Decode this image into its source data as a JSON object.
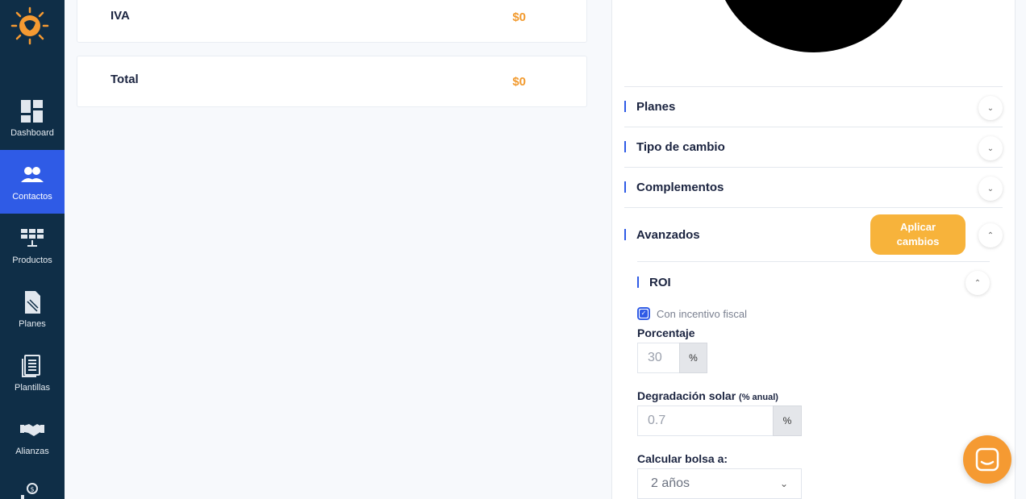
{
  "sidebar": {
    "items": [
      {
        "label": "Dashboard"
      },
      {
        "label": "Contactos"
      },
      {
        "label": "Productos"
      },
      {
        "label": "Planes"
      },
      {
        "label": "Plantillas"
      },
      {
        "label": "Alianzas"
      }
    ],
    "active_color": "#2f5be6",
    "bg_color": "#0f2e47"
  },
  "summary": {
    "iva": {
      "label": "IVA",
      "value": "$0"
    },
    "total": {
      "label": "Total",
      "value": "$0"
    },
    "value_color": "#f29a2e"
  },
  "panel": {
    "accordions": [
      {
        "title": "Planes"
      },
      {
        "title": "Tipo de cambio"
      },
      {
        "title": "Complementos"
      },
      {
        "title": "Avanzados"
      }
    ],
    "apply_button": {
      "line1": "Aplicar",
      "line2": "cambios",
      "color": "#f7b33b"
    },
    "roi": {
      "title": "ROI",
      "incentive_label": "Con incentivo fiscal",
      "incentive_checked": true,
      "porcentaje": {
        "label": "Porcentaje",
        "value": "30",
        "unit": "%"
      },
      "degradacion": {
        "label": "Degradación solar",
        "hint": "(% anual)",
        "value": "0.7",
        "unit": "%"
      },
      "bolsa": {
        "label": "Calcular bolsa a:",
        "selected": "2 años"
      }
    }
  },
  "icons": [
    "logo-icon",
    "dashboard-icon",
    "contacts-icon",
    "products-icon",
    "plans-icon",
    "templates-icon",
    "alliances-icon",
    "chat-icon"
  ]
}
